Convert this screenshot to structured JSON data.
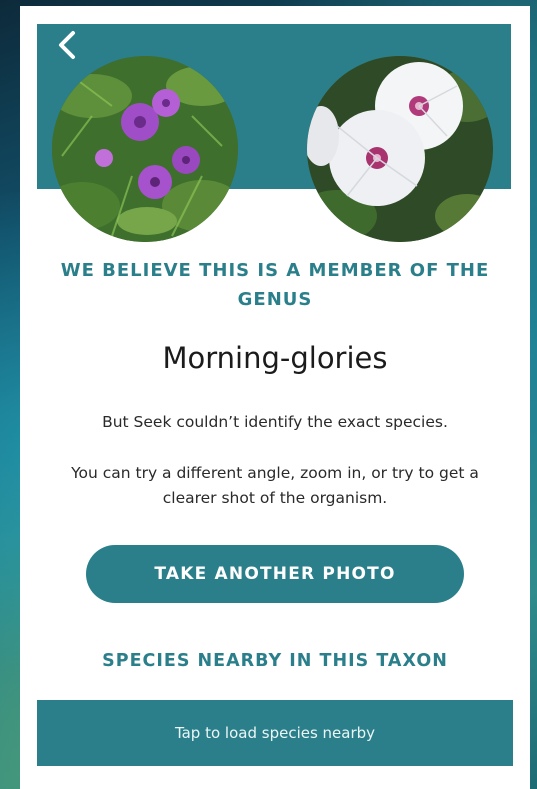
{
  "header": {
    "back_icon": "chevron-left-icon",
    "user_photo_alt": "",
    "match_photo_alt": ""
  },
  "result": {
    "kicker": "WE BELIEVE THIS IS A MEMBER OF THE GENUS",
    "name": "Morning-glories",
    "note_1": "But Seek couldn’t identify the exact species.",
    "note_2": "You can try a different angle, zoom in, or try to get a clearer shot of the organism."
  },
  "actions": {
    "take_photo_label": "TAKE ANOTHER PHOTO"
  },
  "nearby": {
    "heading": "SPECIES NEARBY IN THIS TAXON",
    "load_label": "Tap to load species nearby"
  },
  "colors": {
    "accent": "#2b7f8b",
    "background": "#ffffff"
  }
}
